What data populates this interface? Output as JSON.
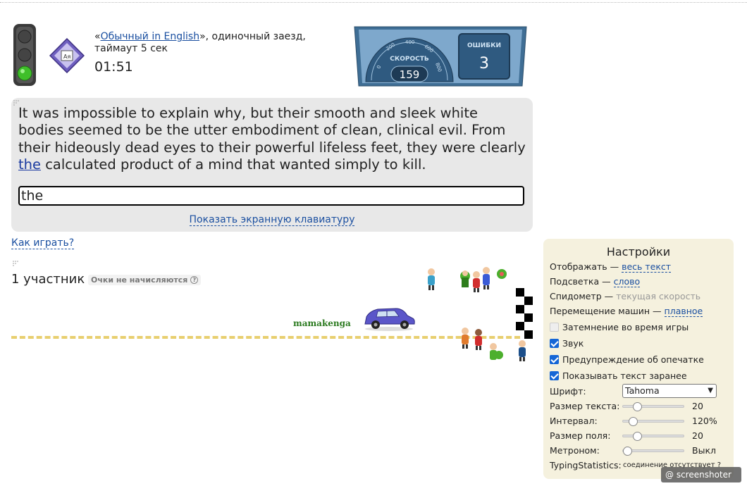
{
  "header": {
    "quote_open": "«",
    "mode_link": "Обычный in English",
    "quote_close": "», одиночный заезд,",
    "timeout": "таймаут 5 сек",
    "timer": "01:51"
  },
  "speedometer": {
    "label": "СКОРОСТЬ",
    "ticks": [
      "0",
      "200",
      "400",
      "600",
      "800"
    ],
    "value": "159",
    "errors_label": "ОШИБКИ",
    "errors_value": "3"
  },
  "passage": {
    "before": "It was impossible to explain why, but their smooth and sleek white bodies seemed to be the utter embodiment of clean, clinical evil. From their hideously dead eyes to their powerful lifeless feet, they were clearly ",
    "current": "the",
    "after": " calculated product of a mind that wanted simply to kill."
  },
  "input": {
    "value": "the"
  },
  "keyboard_link": "Показать экранную клавиатуру",
  "how_to_play": "Как играть?",
  "race": {
    "participants": "1 участник",
    "no_points": "Очки не начисляются",
    "help_mark": "?",
    "racer_name": "mamakenga",
    "progress": 0.7
  },
  "settings": {
    "title": "Настройки",
    "display_label": "Отображать —",
    "display_value": "весь текст",
    "highlight_label": "Подсветка —",
    "highlight_value": "слово",
    "speedo_label": "Спидометр —",
    "speedo_value": "текущая скорость",
    "movement_label": "Перемещение машин —",
    "movement_value": "плавное",
    "dim_label": "Затемнение во время игры",
    "sound_label": "Звук",
    "typo_label": "Предупреждение об опечатке",
    "show_text_label": "Показывать текст заранее",
    "font_label": "Шрифт:",
    "font_value": "Tahoma",
    "text_size_label": "Размер текста:",
    "text_size_value": "20",
    "interval_label": "Интервал:",
    "interval_value": "120%",
    "field_size_label": "Размер поля:",
    "field_size_value": "20",
    "metronome_label": "Метроном:",
    "metronome_value": "Выкл",
    "ts_label": "TypingStatistics:",
    "ts_value": "соединение отсутствует ?"
  },
  "watermark": "@ screenshoter",
  "colors": {
    "link": "#1a4fa0",
    "racer_name": "#2b7a1f",
    "track": "#e8cf6f",
    "settings_bg": "#f5f1de",
    "textbox_bg": "#e8e8e8"
  }
}
